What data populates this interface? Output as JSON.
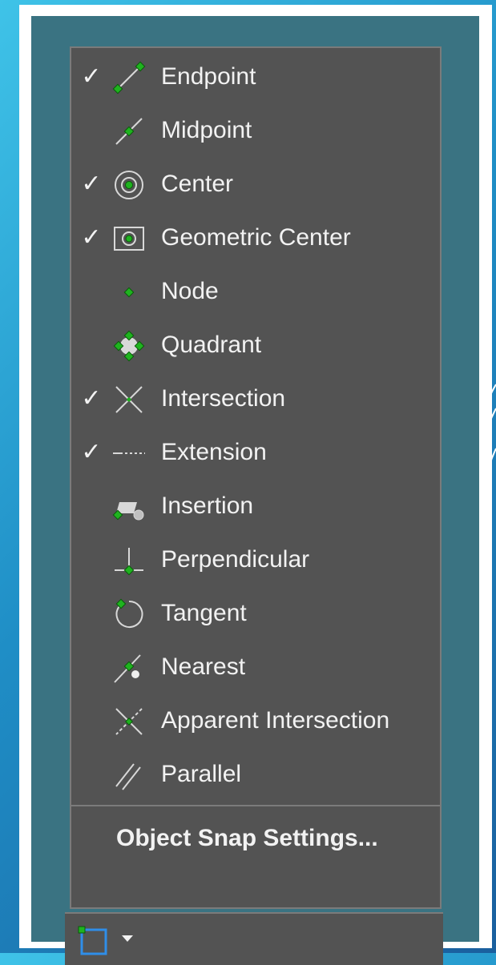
{
  "menu": {
    "items": [
      {
        "label": "Endpoint",
        "checked": true,
        "icon": "endpoint-icon"
      },
      {
        "label": "Midpoint",
        "checked": false,
        "icon": "midpoint-icon"
      },
      {
        "label": "Center",
        "checked": true,
        "icon": "center-icon"
      },
      {
        "label": "Geometric Center",
        "checked": true,
        "icon": "geometric-center-icon"
      },
      {
        "label": "Node",
        "checked": false,
        "icon": "node-icon"
      },
      {
        "label": "Quadrant",
        "checked": false,
        "icon": "quadrant-icon"
      },
      {
        "label": "Intersection",
        "checked": true,
        "icon": "intersection-icon"
      },
      {
        "label": "Extension",
        "checked": true,
        "icon": "extension-icon"
      },
      {
        "label": "Insertion",
        "checked": false,
        "icon": "insertion-icon"
      },
      {
        "label": "Perpendicular",
        "checked": false,
        "icon": "perpendicular-icon"
      },
      {
        "label": "Tangent",
        "checked": false,
        "icon": "tangent-icon"
      },
      {
        "label": "Nearest",
        "checked": false,
        "icon": "nearest-icon"
      },
      {
        "label": "Apparent Intersection",
        "checked": false,
        "icon": "apparent-intersection-icon"
      },
      {
        "label": "Parallel",
        "checked": false,
        "icon": "parallel-icon"
      }
    ],
    "checkmark": "✓",
    "settings_label": "Object Snap Settings..."
  },
  "toolbar": {
    "osnap_icon": "object-snap-icon",
    "dropdown_icon": "dropdown-arrow-icon"
  },
  "colors": {
    "menu_bg": "#535353",
    "panel_bg": "#3a7382",
    "snap_marker": "#1fb31f",
    "accent_blue": "#2f8ee8",
    "text": "#f2f2f2"
  }
}
